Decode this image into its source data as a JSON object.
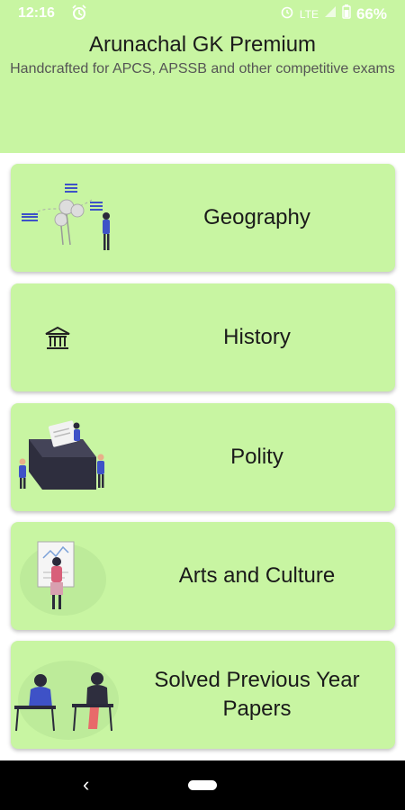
{
  "status_bar": {
    "time": "12:16",
    "network": "LTE",
    "battery": "66%"
  },
  "header": {
    "title": "Arunachal GK Premium",
    "subtitle": "Handcrafted for APCS, APSSB and other competitive exams"
  },
  "categories": [
    {
      "label": "Geography",
      "icon": "geography-illustration"
    },
    {
      "label": "History",
      "icon": "museum-icon"
    },
    {
      "label": "Polity",
      "icon": "ballot-box-illustration"
    },
    {
      "label": "Arts and Culture",
      "icon": "art-gallery-illustration"
    },
    {
      "label": "Solved Previous Year Papers",
      "icon": "students-studying-illustration"
    }
  ],
  "colors": {
    "accent": "#c8f5a2"
  }
}
